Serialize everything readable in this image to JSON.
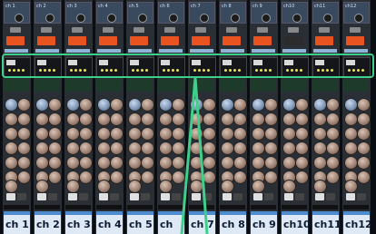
{
  "strips": [
    {
      "hdr": "ch 1",
      "name": "ch 1"
    },
    {
      "hdr": "ch 2",
      "name": "ch 2"
    },
    {
      "hdr": "ch 3",
      "name": "ch 3"
    },
    {
      "hdr": "ch 4",
      "name": "ch 4"
    },
    {
      "hdr": "ch 5",
      "name": "ch 5"
    },
    {
      "hdr": "ch 6",
      "name": "ch"
    },
    {
      "hdr": "ch 7",
      "name": "ch 7"
    },
    {
      "hdr": "ch 8",
      "name": "ch 8"
    },
    {
      "hdr": "ch 9",
      "name": "ch 9"
    },
    {
      "hdr": "ch10",
      "name": "ch10"
    },
    {
      "hdr": "ch11",
      "name": "ch11"
    },
    {
      "hdr": "ch12",
      "name": "ch12"
    }
  ],
  "colors": {
    "highlight": "#3fcf8a",
    "channel_button": "#e8531f",
    "name_bar": "#dfe8f5"
  }
}
